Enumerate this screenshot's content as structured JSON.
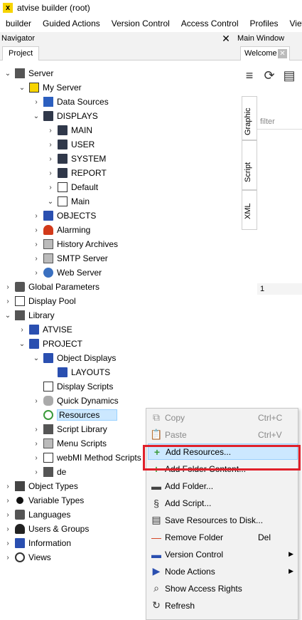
{
  "window": {
    "title": "atvise builder  (root)",
    "logo": "x"
  },
  "menubar": [
    "builder",
    "Guided Actions",
    "Version Control",
    "Access Control",
    "Profiles",
    "Views"
  ],
  "navigator": {
    "title": "Navigator",
    "close": "✕",
    "tab": "Project"
  },
  "tree": [
    {
      "label": "Server",
      "icon": "server-icon",
      "arrow": "⌄",
      "depth": 0
    },
    {
      "label": "My Server",
      "icon": "my-server-icon",
      "arrow": "⌄",
      "depth": 1
    },
    {
      "label": "Data Sources",
      "icon": "data-sources-icon",
      "arrow": "›",
      "depth": 2
    },
    {
      "label": "DISPLAYS",
      "icon": "folder-icon",
      "arrow": "⌄",
      "depth": 2
    },
    {
      "label": "MAIN",
      "icon": "folder-icon",
      "arrow": "›",
      "depth": 3
    },
    {
      "label": "USER",
      "icon": "folder-icon",
      "arrow": "›",
      "depth": 3
    },
    {
      "label": "SYSTEM",
      "icon": "folder-icon",
      "arrow": "›",
      "depth": 3
    },
    {
      "label": "REPORT",
      "icon": "folder-icon",
      "arrow": "›",
      "depth": 3
    },
    {
      "label": "Default",
      "icon": "display-icon",
      "arrow": "›",
      "depth": 3
    },
    {
      "label": "Main",
      "icon": "display-icon",
      "arrow": "⌄",
      "depth": 3
    },
    {
      "label": "OBJECTS",
      "icon": "folder-blue-icon",
      "arrow": "›",
      "depth": 2
    },
    {
      "label": "Alarming",
      "icon": "alarm-bell-icon",
      "arrow": "›",
      "depth": 2
    },
    {
      "label": "History Archives",
      "icon": "history-archives-icon",
      "arrow": "›",
      "depth": 2
    },
    {
      "label": "SMTP Server",
      "icon": "smtp-icon",
      "arrow": "›",
      "depth": 2
    },
    {
      "label": "Web Server",
      "icon": "web-server-icon",
      "arrow": "›",
      "depth": 2
    },
    {
      "label": "Global Parameters",
      "icon": "camera-icon",
      "arrow": "›",
      "depth": 0
    },
    {
      "label": "Display Pool",
      "icon": "display-pool-icon",
      "arrow": "›",
      "depth": 0
    },
    {
      "label": "Library",
      "icon": "library-icon",
      "arrow": "⌄",
      "depth": 0
    },
    {
      "label": "ATVISE",
      "icon": "folder-blue-icon",
      "arrow": "›",
      "depth": 1
    },
    {
      "label": "PROJECT",
      "icon": "folder-blue-icon",
      "arrow": "⌄",
      "depth": 1
    },
    {
      "label": "Object Displays",
      "icon": "folder-blue-icon",
      "arrow": "⌄",
      "depth": 2
    },
    {
      "label": "LAYOUTS",
      "icon": "folder-blue-icon",
      "arrow": "",
      "depth": 3
    },
    {
      "label": "Display Scripts",
      "icon": "script-icon",
      "arrow": "",
      "depth": 2
    },
    {
      "label": "Quick Dynamics",
      "icon": "database-icon",
      "arrow": "›",
      "depth": 2
    },
    {
      "label": "Resources",
      "icon": "resources-icon",
      "arrow": "",
      "depth": 2,
      "selected": true
    },
    {
      "label": "Script Library",
      "icon": "script-library-icon",
      "arrow": "›",
      "depth": 2
    },
    {
      "label": "Menu Scripts",
      "icon": "menu-scripts-icon",
      "arrow": "›",
      "depth": 2
    },
    {
      "label": "webMI Method Scripts",
      "icon": "webmi-icon",
      "arrow": "›",
      "depth": 2
    },
    {
      "label": "de",
      "icon": "translation-icon",
      "arrow": "›",
      "depth": 2
    },
    {
      "label": "Object Types",
      "icon": "cube-icon",
      "arrow": "›",
      "depth": 0
    },
    {
      "label": "Variable Types",
      "icon": "dot-icon",
      "arrow": "›",
      "depth": 0
    },
    {
      "label": "Languages",
      "icon": "languages-icon",
      "arrow": "›",
      "depth": 0
    },
    {
      "label": "Users & Groups",
      "icon": "person-icon",
      "arrow": "›",
      "depth": 0
    },
    {
      "label": "Information",
      "icon": "folder-blue-icon",
      "arrow": "›",
      "depth": 0
    },
    {
      "label": "Views",
      "icon": "search-icon",
      "arrow": "›",
      "depth": 0
    }
  ],
  "main": {
    "title": "Main Window",
    "tab": "Welcome",
    "tab_close": "✕",
    "vtabs": [
      "Graphic",
      "Script",
      "XML"
    ],
    "filter_placeholder": "filter",
    "line_number": "1"
  },
  "context_menu": [
    {
      "label": "Copy",
      "shortcut": "Ctrl+C",
      "icon": "copy-icon",
      "disabled": true
    },
    {
      "label": "Paste",
      "shortcut": "Ctrl+V",
      "icon": "paste-icon",
      "disabled": true
    },
    {
      "label": "Add Resources...",
      "shortcut": "",
      "icon": "plus-icon",
      "highlight": true
    },
    {
      "label": "Add Folder Content...",
      "shortcut": "",
      "icon": "plus-icon"
    },
    {
      "label": "Add Folder...",
      "shortcut": "",
      "icon": "add-folder-icon"
    },
    {
      "label": "Add Script...",
      "shortcut": "",
      "icon": "add-script-icon"
    },
    {
      "label": "Save Resources to Disk...",
      "shortcut": "",
      "icon": "save-icon"
    },
    {
      "label": "Remove Folder",
      "shortcut": "Del",
      "icon": "minus-icon"
    },
    {
      "label": "Version Control",
      "shortcut": "",
      "icon": "version-control-icon",
      "submenu": true
    },
    {
      "label": "Node Actions",
      "shortcut": "",
      "icon": "node-actions-icon",
      "submenu": true
    },
    {
      "label": "Show Access Rights",
      "shortcut": "",
      "icon": "search-icon"
    },
    {
      "label": "Refresh",
      "shortcut": "",
      "icon": "refresh-icon"
    }
  ],
  "colors": {
    "selection": "#cce8ff",
    "highlight_border": "#e0202a",
    "plus": "#3a9a3a",
    "minus": "#d23a1a"
  }
}
